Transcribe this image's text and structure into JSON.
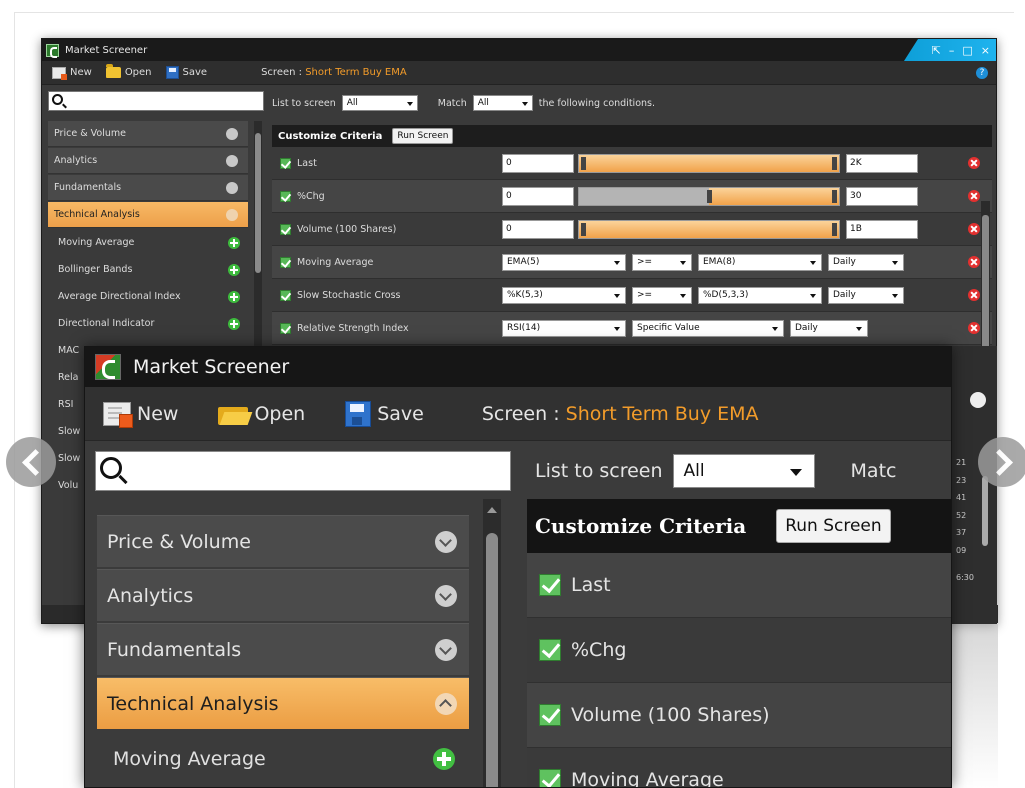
{
  "window_title": "Market Screener",
  "toolbar": {
    "new_label": "New",
    "open_label": "Open",
    "save_label": "Save",
    "screen_label": "Screen : ",
    "screen_name": "Short Term Buy EMA"
  },
  "filter": {
    "list_to_screen_label": "List to screen",
    "list_value": "All",
    "match_label": "Match",
    "match_label_clipped": "Matc",
    "match_value": "All",
    "following_label": "the following conditions."
  },
  "criteria": {
    "header": "Customize Criteria",
    "run_label": "Run Screen"
  },
  "categories": [
    {
      "label": "Price & Volume"
    },
    {
      "label": "Analytics"
    },
    {
      "label": "Fundamentals"
    },
    {
      "label": "Technical Analysis"
    }
  ],
  "small_sub_items": [
    "Moving Average",
    "Bollinger Bands",
    "Average Directional Index",
    "Directional Indicator",
    "MAC",
    "Rela",
    "RSI",
    "Slow",
    "Slow",
    "Volu"
  ],
  "big_sub_items": [
    "Moving Average"
  ],
  "small_rows": [
    {
      "label": "Last",
      "min": "0",
      "max": "2K"
    },
    {
      "label": "%Chg",
      "min": "0",
      "max": "30"
    },
    {
      "label": "Volume (100 Shares)",
      "min": "0",
      "max": "1B"
    },
    {
      "label": "Moving Average",
      "dd1": "EMA(5)",
      "op": ">=",
      "dd2": "EMA(8)",
      "period": "Daily"
    },
    {
      "label": "Slow Stochastic Cross",
      "dd1": "%K(5,3)",
      "op": ">=",
      "dd2": "%D(5,3,3)",
      "period": "Daily"
    },
    {
      "label": "Relative Strength Index",
      "dd1": "RSI(14)",
      "op": "Specific Value",
      "period": "Daily"
    }
  ],
  "big_rows": [
    "Last",
    "%Chg",
    "Volume (100 Shares)",
    "Moving Average"
  ],
  "right_clip_values": [
    "21",
    "23",
    "41",
    "52",
    "37",
    "09",
    "6:30"
  ],
  "colors": {
    "accent_orange": "#f39c2a",
    "active_category": "#eda04a",
    "check_green": "#57b857",
    "delete_red": "#e2302f",
    "title_bar": "#161616",
    "caption_blue": "#0e9fd8"
  },
  "icons": {
    "new": "new-document-icon",
    "open": "folder-open-icon",
    "save": "floppy-disk-icon",
    "search": "search-icon",
    "expand": "chevron-down-icon",
    "add": "plus-circle-icon",
    "remove": "remove-circle-icon"
  }
}
